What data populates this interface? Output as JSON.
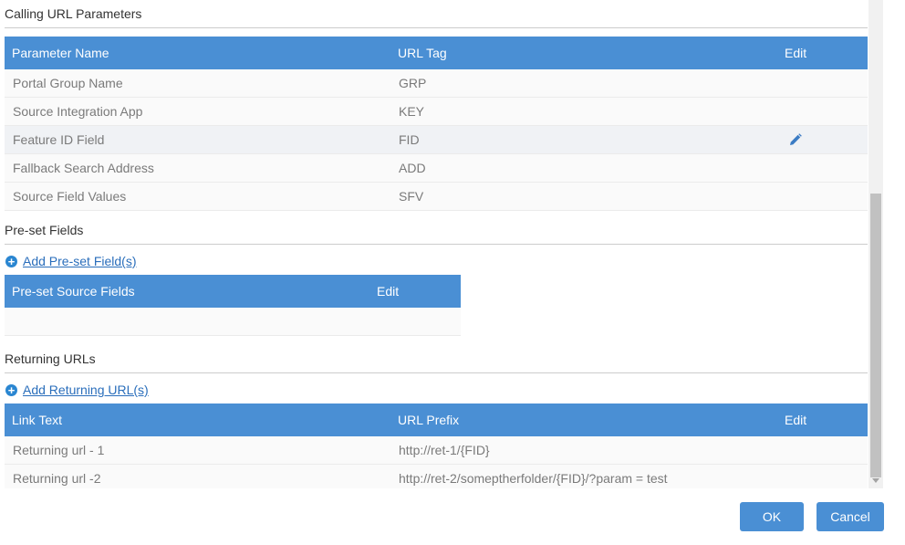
{
  "calling_url_parameters": {
    "title": "Calling URL Parameters",
    "columns": [
      "Parameter Name",
      "URL Tag",
      "Edit"
    ],
    "rows": [
      {
        "name": "Portal Group Name",
        "tag": "GRP"
      },
      {
        "name": "Source Integration App",
        "tag": "KEY"
      },
      {
        "name": "Feature ID Field",
        "tag": "FID",
        "edit_icon": "pencil-icon"
      },
      {
        "name": "Fallback Search Address",
        "tag": "ADD"
      },
      {
        "name": "Source Field Values",
        "tag": "SFV"
      }
    ]
  },
  "preset_fields": {
    "title": "Pre-set Fields",
    "add_link": "Add Pre-set Field(s)",
    "add_icon": "plus-circle-icon",
    "columns": [
      "Pre-set Source Fields",
      "Edit"
    ]
  },
  "returning_urls": {
    "title": "Returning URLs",
    "add_link": "Add Returning URL(s)",
    "add_icon": "plus-circle-icon",
    "columns": [
      "Link Text",
      "URL Prefix",
      "Edit"
    ],
    "rows": [
      {
        "link_text": "Returning url - 1",
        "url_prefix": "http://ret-1/{FID}"
      },
      {
        "link_text": "Returning url -2",
        "url_prefix": "http://ret-2/someptherfolder/{FID}/?param = test"
      }
    ]
  },
  "footer": {
    "ok_label": "OK",
    "cancel_label": "Cancel"
  },
  "colors": {
    "header_bg": "#4a8fd4",
    "button_bg": "#4a8fd4",
    "link": "#2a6ebb",
    "row_highlight": "#f0f2f5"
  }
}
